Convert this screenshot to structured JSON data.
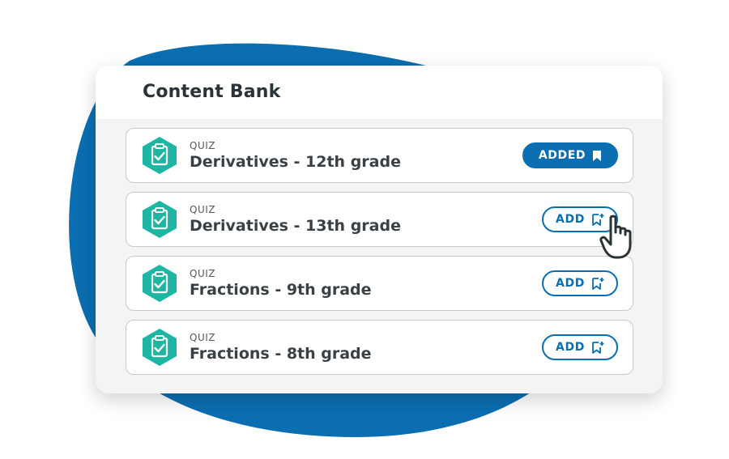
{
  "panel": {
    "title": "Content Bank"
  },
  "items": [
    {
      "type": "QUIZ",
      "title": "Derivatives - 12th grade",
      "button": "ADDED",
      "added": true
    },
    {
      "type": "QUIZ",
      "title": "Derivatives - 13th grade",
      "button": "ADD",
      "added": false
    },
    {
      "type": "QUIZ",
      "title": "Fractions - 9th grade",
      "button": "ADD",
      "added": false
    },
    {
      "type": "QUIZ",
      "title": "Fractions - 8th grade",
      "button": "ADD",
      "added": false
    }
  ],
  "icons": {
    "item": "quiz-clipboard-icon",
    "added": "bookmark-filled-icon",
    "add": "bookmark-add-icon",
    "pointer": "hand-pointer-cursor"
  },
  "colors": {
    "accent": "#0a6eb0",
    "icon_teal": "#1fb5a3",
    "background_blob": "#0a6eb0"
  }
}
